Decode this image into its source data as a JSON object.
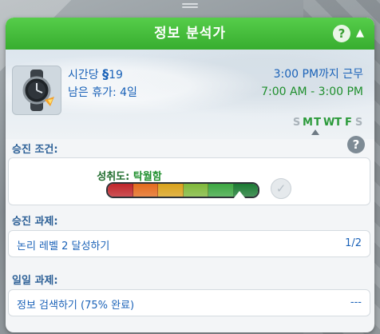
{
  "window": {
    "title": "정보 분석가",
    "help_symbol": "?",
    "collapse_symbol": "▲"
  },
  "career": {
    "icon": "smartwatch-icon",
    "hourly_pay_label": "시간당",
    "pay_currency": "§",
    "hourly_pay_value": "19",
    "vacation_text": "남은 휴가: 4일",
    "work_until": "3:00 PM까지 근무",
    "hours": "7:00 AM - 3:00 PM",
    "days": [
      {
        "label": "S",
        "work": false
      },
      {
        "label": "M",
        "work": true
      },
      {
        "label": "T",
        "work": true
      },
      {
        "label": "W",
        "work": true
      },
      {
        "label": "T",
        "work": true
      },
      {
        "label": "F",
        "work": true
      },
      {
        "label": "S",
        "work": false
      }
    ]
  },
  "promotion": {
    "section_label": "승진 조건:",
    "help_symbol": "?",
    "performance_label": "성취도:",
    "performance_value": "탁월함",
    "performance_level": 0.87,
    "bar_colors": [
      "#c0262b",
      "#e36b1d",
      "#d9a21c",
      "#7fb83a",
      "#3da742",
      "#1b7a33"
    ],
    "check_symbol": "✓"
  },
  "promotion_tasks": {
    "section_label": "승진 과제:",
    "items": [
      {
        "text": "논리 레벨 2 달성하기",
        "progress": "1/2"
      }
    ]
  },
  "daily_tasks": {
    "section_label": "일일 과제:",
    "items": [
      {
        "text": "정보 검색하기 (75% 완료)",
        "progress": "---"
      }
    ]
  }
}
